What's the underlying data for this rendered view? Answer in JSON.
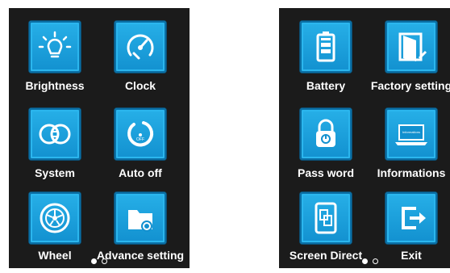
{
  "screens": [
    {
      "items": [
        {
          "label": "Brightness",
          "icon": "brightness-icon"
        },
        {
          "label": "Clock",
          "icon": "clock-icon"
        },
        {
          "label": "System",
          "icon": "system-icon"
        },
        {
          "label": "Auto off",
          "icon": "auto-off-icon"
        },
        {
          "label": "Wheel",
          "icon": "wheel-icon"
        },
        {
          "label": "Advance setting",
          "icon": "advance-setting-icon"
        }
      ],
      "page_indicator": {
        "current": 1,
        "total": 2
      }
    },
    {
      "items": [
        {
          "label": "Battery",
          "icon": "battery-icon"
        },
        {
          "label": "Factory setting",
          "icon": "factory-setting-icon"
        },
        {
          "label": "Pass word",
          "icon": "password-icon"
        },
        {
          "label": "Informations",
          "icon": "informations-icon"
        },
        {
          "label": "Screen Direct",
          "icon": "screen-direct-icon"
        },
        {
          "label": "Exit",
          "icon": "exit-icon"
        }
      ],
      "info_screen_text": "Informations",
      "page_indicator": {
        "current": 1,
        "total": 2
      }
    }
  ],
  "colors": {
    "panel_bg": "#1b1b1b",
    "tile": "#1a9ad8",
    "text": "#ffffff"
  }
}
